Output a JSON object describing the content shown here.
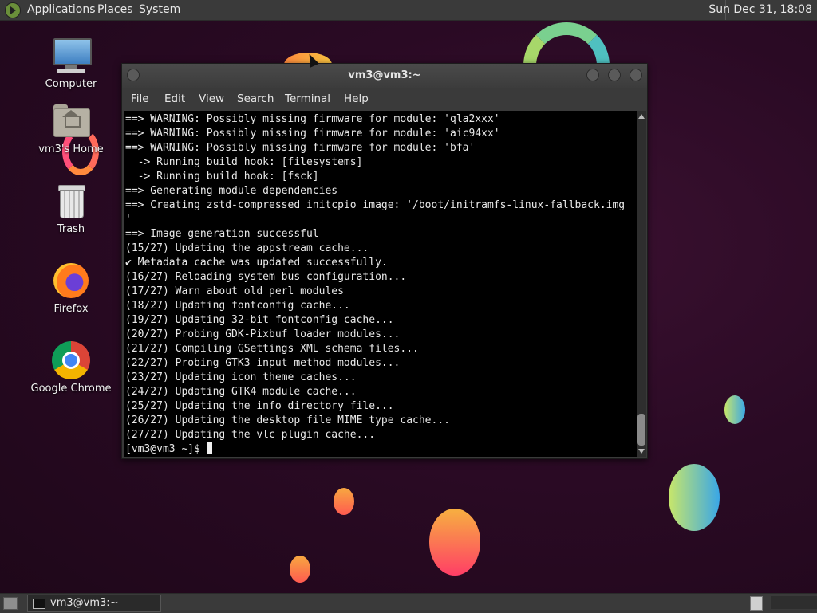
{
  "top_panel": {
    "menus": [
      "Applications",
      "Places",
      "System"
    ],
    "clock": "Sun Dec 31, 18:08"
  },
  "desktop_icons": [
    {
      "label": "Computer",
      "icon": "computer-icon"
    },
    {
      "label": "vm3's Home",
      "icon": "home-folder-icon"
    },
    {
      "label": "Trash",
      "icon": "trash-icon"
    },
    {
      "label": "Firefox",
      "icon": "firefox-icon"
    },
    {
      "label": "Google Chrome",
      "icon": "chrome-icon"
    }
  ],
  "terminal": {
    "title": "vm3@vm3:~",
    "menu": [
      "File",
      "Edit",
      "View",
      "Search",
      "Terminal",
      "Help"
    ],
    "lines": [
      "==> WARNING: Possibly missing firmware for module: 'qla2xxx'",
      "==> WARNING: Possibly missing firmware for module: 'aic94xx'",
      "==> WARNING: Possibly missing firmware for module: 'bfa'",
      "  -> Running build hook: [filesystems]",
      "  -> Running build hook: [fsck]",
      "==> Generating module dependencies",
      "==> Creating zstd-compressed initcpio image: '/boot/initramfs-linux-fallback.img",
      "'",
      "==> Image generation successful",
      "(15/27) Updating the appstream cache...",
      "✔ Metadata cache was updated successfully.",
      "(16/27) Reloading system bus configuration...",
      "(17/27) Warn about old perl modules",
      "(18/27) Updating fontconfig cache...",
      "(19/27) Updating 32-bit fontconfig cache...",
      "(20/27) Probing GDK-Pixbuf loader modules...",
      "(21/27) Compiling GSettings XML schema files...",
      "(22/27) Probing GTK3 input method modules...",
      "(23/27) Updating icon theme caches...",
      "(24/27) Updating GTK4 module cache...",
      "(25/27) Updating the info directory file...",
      "(26/27) Updating the desktop file MIME type cache...",
      "(27/27) Updating the vlc plugin cache..."
    ],
    "prompt": "[vm3@vm3 ~]$ "
  },
  "taskbar": {
    "window_button": "vm3@vm3:~"
  }
}
